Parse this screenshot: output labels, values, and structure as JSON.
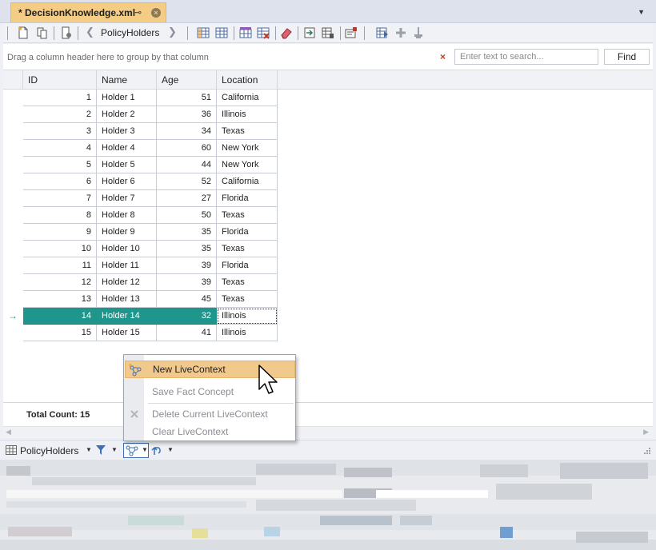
{
  "tab": {
    "title": "* DecisionKnowledge.xml",
    "pin_glyph": "⊸",
    "close_glyph": "×"
  },
  "toolbar": {
    "table_label": "PolicyHolders",
    "icons": [
      "new-document-icon",
      "copy-document-icon",
      "settings-document-icon",
      "back-arrow-icon",
      "forward-arrow-icon",
      "insert-column-icon",
      "table-icon",
      "add-row-icon",
      "delete-row-icon",
      "eraser-icon",
      "import-icon",
      "export-table-icon",
      "properties-icon",
      "run-icon",
      "add-icon",
      "anchor-icon"
    ]
  },
  "group_panel": {
    "hint": "Drag a column header here to group by that column",
    "clear_glyph": "×",
    "search_placeholder": "Enter text to search...",
    "find_label": "Find"
  },
  "grid": {
    "columns": [
      "ID",
      "Name",
      "Age",
      "Location"
    ],
    "rows": [
      {
        "id": "1",
        "name": "Holder 1",
        "age": "51",
        "location": "California"
      },
      {
        "id": "2",
        "name": "Holder 2",
        "age": "36",
        "location": "Illinois"
      },
      {
        "id": "3",
        "name": "Holder 3",
        "age": "34",
        "location": "Texas"
      },
      {
        "id": "4",
        "name": "Holder 4",
        "age": "60",
        "location": "New York"
      },
      {
        "id": "5",
        "name": "Holder 5",
        "age": "44",
        "location": "New York"
      },
      {
        "id": "6",
        "name": "Holder 6",
        "age": "52",
        "location": "California"
      },
      {
        "id": "7",
        "name": "Holder 7",
        "age": "27",
        "location": "Florida"
      },
      {
        "id": "8",
        "name": "Holder 8",
        "age": "50",
        "location": "Texas"
      },
      {
        "id": "9",
        "name": "Holder 9",
        "age": "35",
        "location": "Florida"
      },
      {
        "id": "10",
        "name": "Holder 10",
        "age": "35",
        "location": "Texas"
      },
      {
        "id": "11",
        "name": "Holder 11",
        "age": "39",
        "location": "Florida"
      },
      {
        "id": "12",
        "name": "Holder 12",
        "age": "39",
        "location": "Texas"
      },
      {
        "id": "13",
        "name": "Holder 13",
        "age": "45",
        "location": "Texas"
      },
      {
        "id": "14",
        "name": "Holder 14",
        "age": "32",
        "location": "Illinois"
      },
      {
        "id": "15",
        "name": "Holder 15",
        "age": "41",
        "location": "Illinois"
      }
    ],
    "selected_row": 14,
    "row_indicator_glyph": "→",
    "total_count": "Total Count: 15"
  },
  "bottom_bar": {
    "table_label": "PolicyHolders"
  },
  "context_menu": {
    "items": [
      {
        "label": "New LiveContext",
        "icon": "new-livecontext-icon",
        "highlighted": true
      },
      {
        "label": "Save Fact Concept",
        "icon": "",
        "highlighted": false
      },
      {
        "label": "Delete Current LiveContext",
        "icon": "delete-icon",
        "highlighted": false
      },
      {
        "label": "Clear LiveContext",
        "icon": "",
        "highlighted": false
      }
    ]
  },
  "colors": {
    "tab_active": "#f5cc84",
    "selection": "#1f968c",
    "menu_highlight": "#f2c98c",
    "accent_blue": "#3c6fb4"
  }
}
